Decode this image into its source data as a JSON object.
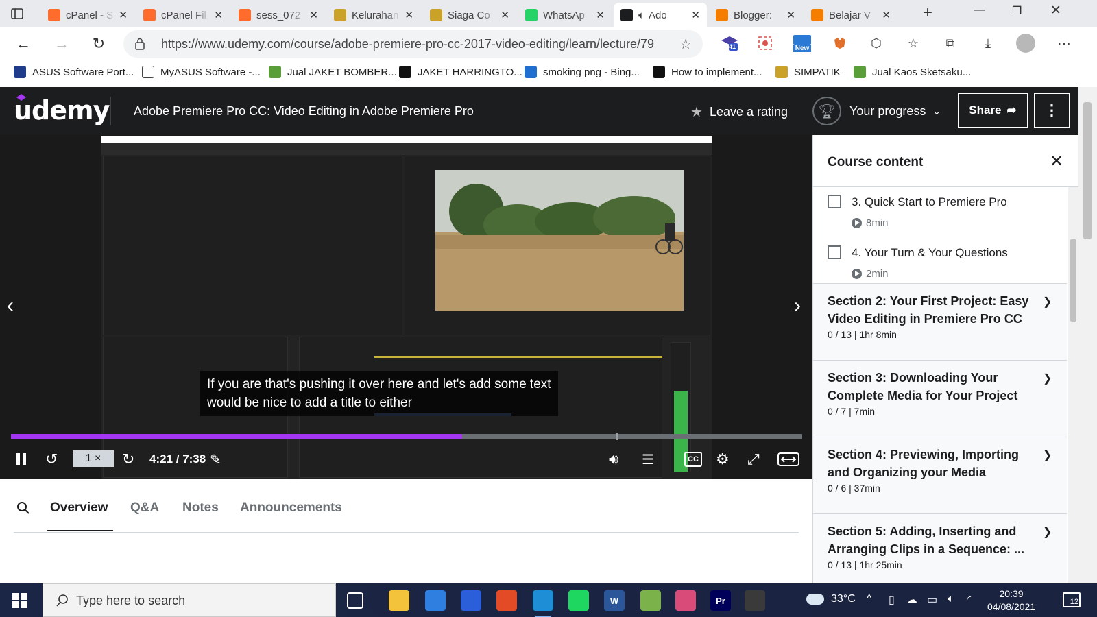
{
  "browser": {
    "tabs": [
      {
        "label": "cPanel - S",
        "icon": "cpanel-icon",
        "color": "#ff6c2c"
      },
      {
        "label": "cPanel Fil",
        "icon": "cpanel-icon",
        "color": "#ff6c2c"
      },
      {
        "label": "sess_072",
        "icon": "cpanel-icon",
        "color": "#ff6c2c"
      },
      {
        "label": "Kelurahan",
        "icon": "crest-icon",
        "color": "#c9a227"
      },
      {
        "label": "Siaga Co",
        "icon": "crest-icon",
        "color": "#c9a227"
      },
      {
        "label": "WhatsAp",
        "icon": "whatsapp-icon",
        "color": "#25d366"
      },
      {
        "label": "Ado",
        "icon": "udemy-icon",
        "color": "#1c1d1f"
      },
      {
        "label": "Blogger:",
        "icon": "blogger-icon",
        "color": "#f57d00"
      },
      {
        "label": "Belajar V",
        "icon": "blogger-icon",
        "color": "#f57d00"
      }
    ],
    "url": "https://www.udemy.com/course/adobe-premiere-pro-cc-2017-video-editing/learn/lecture/79...",
    "extension_badges": {
      "graduation": "41",
      "new": "New"
    },
    "bookmarks": [
      {
        "label": "ASUS Software Port...",
        "icon": "asus-icon"
      },
      {
        "label": "MyASUS Software -...",
        "icon": "page-icon"
      },
      {
        "label": "Jual JAKET BOMBER...",
        "icon": "shop-icon"
      },
      {
        "label": "JAKET HARRINGTO...",
        "icon": "shop-icon"
      },
      {
        "label": "smoking png - Bing...",
        "icon": "bing-icon"
      },
      {
        "label": "How to implement...",
        "icon": "github-icon"
      },
      {
        "label": "SIMPATIK",
        "icon": "crest-icon"
      },
      {
        "label": "Jual Kaos Sketsaku...",
        "icon": "shop-icon"
      }
    ]
  },
  "udemy": {
    "logo": "udemy",
    "course_title": "Adobe Premiere Pro CC: Video Editing in Adobe Premiere Pro",
    "rating_label": "Leave a rating",
    "progress_label": "Your progress",
    "share_label": "Share",
    "accent": "#a435f0"
  },
  "player": {
    "caption_lines": "If you are that's pushing it over here and let's add some text\nwould be nice to add a title to either",
    "speed": "1 ×",
    "time": "4:21 / 7:38",
    "progress_fraction": 0.5706,
    "buffer_fraction": 0.7645,
    "cc_label": "CC"
  },
  "lower_tabs": {
    "items": [
      "Overview",
      "Q&A",
      "Notes",
      "Announcements"
    ],
    "active": "Overview"
  },
  "sidebar": {
    "title": "Course content",
    "lectures": [
      {
        "title": "3. Quick Start to Premiere Pro",
        "duration": "8min"
      },
      {
        "title": "4. Your Turn & Your Questions",
        "duration": "2min"
      }
    ],
    "sections": [
      {
        "title": "Section 2: Your First Project: Easy Video Editing in Premiere Pro CC",
        "meta": "0 / 13 | 1hr 8min"
      },
      {
        "title": "Section 3: Downloading Your Complete Media for Your Project",
        "meta": "0 / 7 | 7min"
      },
      {
        "title": "Section 4: Previewing, Importing and Organizing your Media",
        "meta": "0 / 6 | 37min"
      },
      {
        "title": "Section 5: Adding, Inserting and Arranging Clips in a Sequence: ...",
        "meta": "0 / 13 | 1hr 25min"
      }
    ]
  },
  "taskbar": {
    "search_placeholder": "Type here to search",
    "temperature": "33°C",
    "time": "20:39",
    "date": "04/08/2021",
    "notifications": "12",
    "apps": [
      {
        "name": "task-view-icon",
        "color": "#1b2545",
        "label": ""
      },
      {
        "name": "file-explorer-icon",
        "color": "#f3c43b",
        "label": ""
      },
      {
        "name": "mail-icon",
        "color": "#2f7fe0",
        "label": ""
      },
      {
        "name": "app-icon",
        "color": "#2b5fd9",
        "label": ""
      },
      {
        "name": "office-icon",
        "color": "#e24b26",
        "label": ""
      },
      {
        "name": "edge-icon",
        "color": "#1e8fd6",
        "label": ""
      },
      {
        "name": "spotify-icon",
        "color": "#1ed760",
        "label": ""
      },
      {
        "name": "word-icon",
        "color": "#2b579a",
        "label": "W"
      },
      {
        "name": "notepad-icon",
        "color": "#7bb34a",
        "label": ""
      },
      {
        "name": "snip-icon",
        "color": "#d94c7a",
        "label": ""
      },
      {
        "name": "premiere-icon",
        "color": "#00005b",
        "label": "Pr"
      },
      {
        "name": "image-app-icon",
        "color": "#3a3a3a",
        "label": ""
      }
    ]
  }
}
